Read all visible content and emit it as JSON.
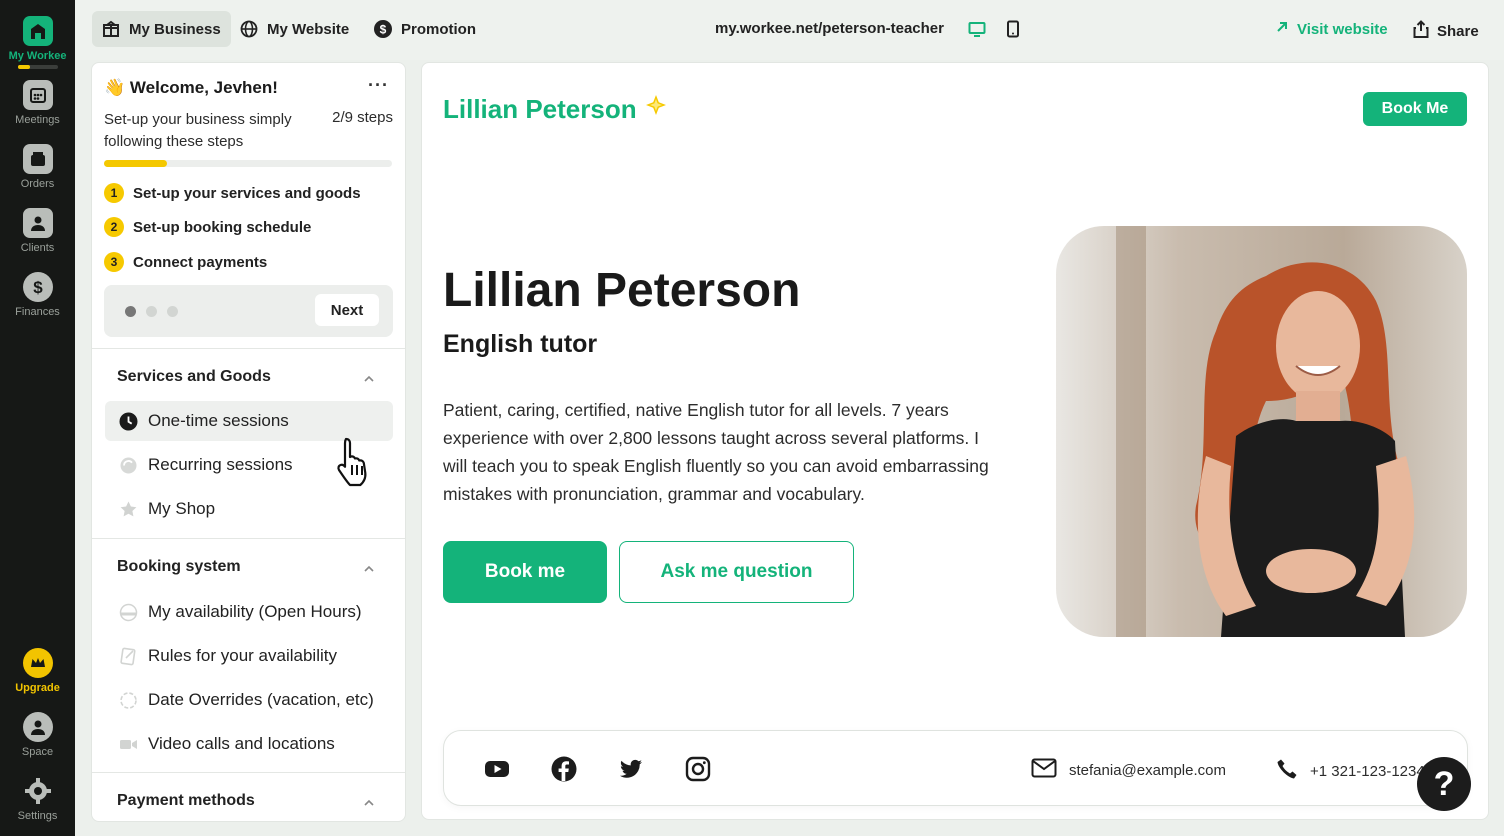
{
  "rail": {
    "logo_label": "My Workee",
    "items": [
      {
        "label": "Meetings",
        "icon": "calendar-icon"
      },
      {
        "label": "Orders",
        "icon": "orders-icon"
      },
      {
        "label": "Clients",
        "icon": "clients-icon"
      },
      {
        "label": "Finances",
        "icon": "dollar-icon"
      }
    ],
    "upgrade_label": "Upgrade",
    "space_label": "Space",
    "settings_label": "Settings"
  },
  "topbar": {
    "tabs": [
      {
        "label": "My Business",
        "icon": "business-icon"
      },
      {
        "label": "My Website",
        "icon": "globe-icon"
      },
      {
        "label": "Promotion",
        "icon": "dollar-circle-icon"
      }
    ],
    "url": "my.workee.net/peterson-teacher",
    "visit_label": "Visit website",
    "share_label": "Share"
  },
  "sidebar": {
    "welcome": "Welcome, Jevhen!",
    "setup_text": "Set-up your business simply following these steps",
    "steps_count": "2/9 steps",
    "progress": 0.22,
    "steps": [
      {
        "num": "1",
        "label": "Set-up your services and goods"
      },
      {
        "num": "2",
        "label": "Set-up booking schedule"
      },
      {
        "num": "3",
        "label": "Connect payments"
      }
    ],
    "next_label": "Next",
    "sections": [
      {
        "title": "Services and Goods",
        "items": [
          "One-time sessions",
          "Recurring sessions",
          "My Shop"
        ]
      },
      {
        "title": "Booking system",
        "items": [
          "My availability (Open Hours)",
          "Rules for your availability",
          "Date Overrides (vacation, etc)",
          "Video calls and locations"
        ]
      },
      {
        "title": "Payment methods",
        "items": []
      }
    ]
  },
  "main": {
    "brand": "Lillian Peterson",
    "book_top": "Book Me",
    "name": "Lillian Peterson",
    "role": "English tutor",
    "bio": "Patient, caring, certified, native English tutor for all levels. 7 years experience with over 2,800 lessons taught across several platforms. I will teach you to speak English fluently so you can avoid embarrassing mistakes with pronunciation, grammar and vocabulary.",
    "book_btn": "Book me",
    "ask_btn": "Ask me question",
    "email": "stefania@example.com",
    "phone": "+1 321-123-1234"
  },
  "colors": {
    "accent": "#14b37a",
    "yellow": "#f6c900",
    "rail": "#161816"
  }
}
